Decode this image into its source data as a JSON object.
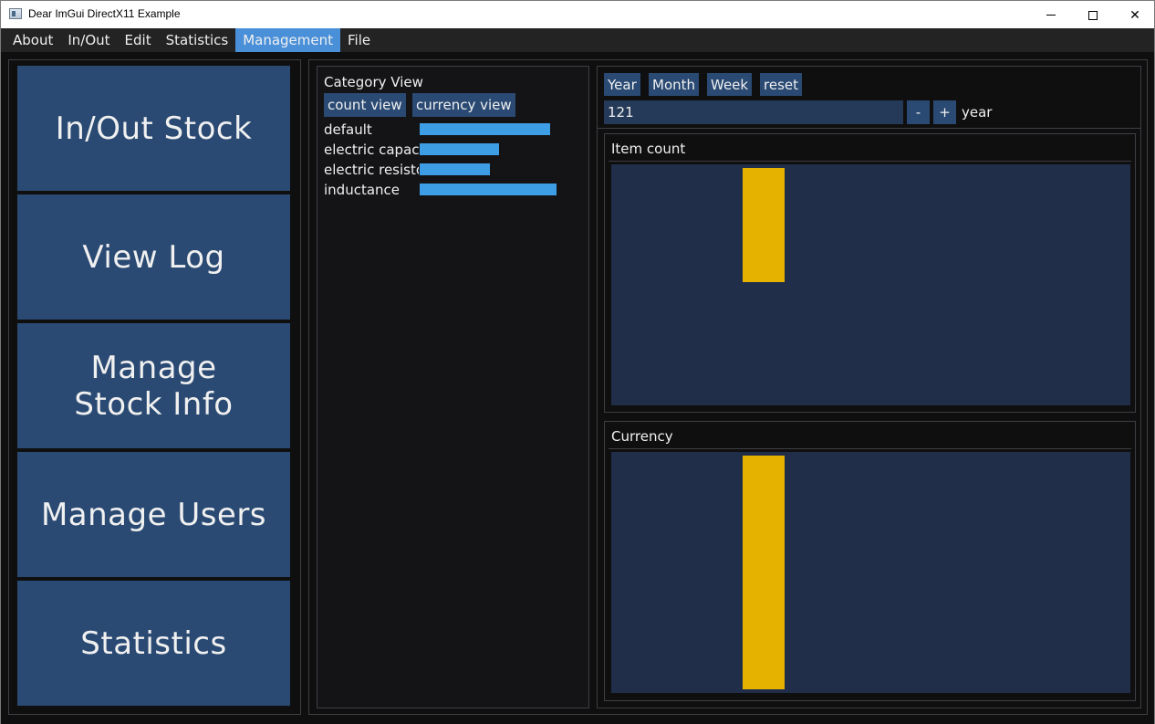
{
  "window": {
    "title": "Dear ImGui DirectX11 Example",
    "icons": {
      "app": "app-window-icon",
      "minimize": "minimize-icon",
      "maximize": "maximize-icon",
      "close": "close-icon"
    },
    "close_glyph": "✕"
  },
  "menu": {
    "items": [
      "About",
      "In/Out",
      "Edit",
      "Statistics",
      "Management",
      "File"
    ],
    "active": "Management",
    "active_color": "#4a90d9"
  },
  "nav": {
    "buttons": [
      "In/Out Stock",
      "View Log",
      "Manage Stock Info",
      "Manage Users",
      "Statistics"
    ],
    "button_color": "#2a4a73"
  },
  "category_view": {
    "title": "Category View",
    "buttons": [
      "count view",
      "currency view"
    ],
    "rows": [
      {
        "label": "default",
        "level": 0.95
      },
      {
        "label": "electric capacitor",
        "level": 0.58
      },
      {
        "label": "electric resistor",
        "level": 0.51
      },
      {
        "label": "inductance",
        "level": 1.0
      }
    ],
    "bar_color": "#3d9ee6"
  },
  "period": {
    "buttons": [
      "Year",
      "Month",
      "Week",
      "reset"
    ],
    "value": "121",
    "minus": "-",
    "plus": "+",
    "unit": "year"
  },
  "charts": [
    {
      "title": "Item count",
      "bar_color": "#e6b200",
      "bar_level": 0.49
    },
    {
      "title": "Currency",
      "bar_color": "#e6b200",
      "bar_level": 1.0
    }
  ]
}
